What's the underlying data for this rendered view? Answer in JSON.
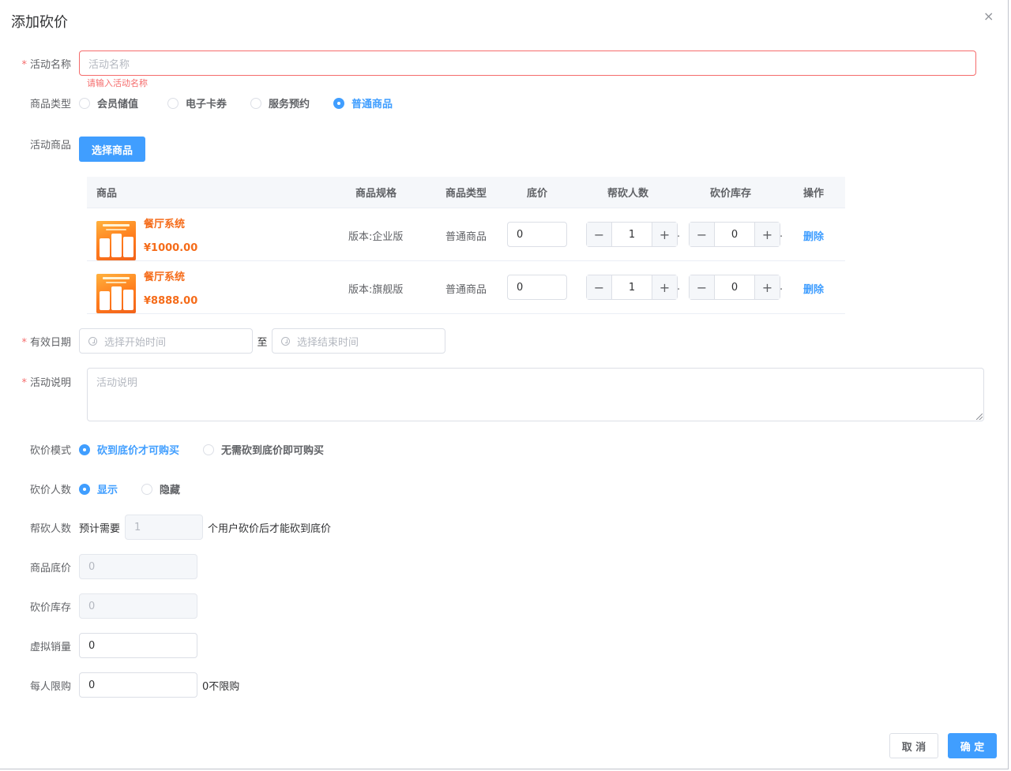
{
  "dialog": {
    "title": "添加砍价",
    "close_glyph": "×"
  },
  "form": {
    "required_mark": "*",
    "activity_name": {
      "label": "活动名称",
      "placeholder": "活动名称",
      "error": "请输入活动名称"
    },
    "product_type": {
      "label": "商品类型",
      "options": [
        "会员储值",
        "电子卡券",
        "服务预约",
        "普通商品"
      ],
      "selected": 3
    },
    "activity_goods": {
      "label": "活动商品",
      "select_button": "选择商品"
    },
    "goods_table": {
      "headers": [
        "商品",
        "商品规格",
        "商品类型",
        "底价",
        "帮砍人数",
        "砍价库存",
        "操作"
      ],
      "rows": [
        {
          "name": "餐厅系统",
          "price": "¥1000.00",
          "spec": "版本:企业版",
          "type": "普通商品",
          "floor_price": "0",
          "helpers": "1",
          "stock": "0",
          "action": "删除"
        },
        {
          "name": "餐厅系统",
          "price": "¥8888.00",
          "spec": "版本:旗舰版",
          "type": "普通商品",
          "floor_price": "0",
          "helpers": "1",
          "stock": "0",
          "action": "删除"
        }
      ],
      "minus": "−",
      "plus": "+",
      "dot": "."
    },
    "valid_date": {
      "label": "有效日期",
      "start_placeholder": "选择开始时间",
      "to": "至",
      "end_placeholder": "选择结束时间"
    },
    "description": {
      "label": "活动说明",
      "placeholder": "活动说明"
    },
    "bargain_mode": {
      "label": "砍价模式",
      "options": [
        "砍到底价才可购买",
        "无需砍到底价即可购买"
      ],
      "selected": 0
    },
    "bargain_count": {
      "label": "砍价人数",
      "options": [
        "显示",
        "隐藏"
      ],
      "selected": 0
    },
    "helper_count": {
      "label": "帮砍人数",
      "prefix": "预计需要",
      "value": "1",
      "suffix": "个用户砍价后才能砍到底价"
    },
    "goods_floor_price": {
      "label": "商品底价",
      "value": "0"
    },
    "bargain_stock": {
      "label": "砍价库存",
      "value": "0"
    },
    "virtual_sales": {
      "label": "虚拟销量",
      "value": "0"
    },
    "purchase_limit": {
      "label": "每人限购",
      "value": "0",
      "hint": "0不限购"
    }
  },
  "footer": {
    "cancel": "取 消",
    "confirm": "确 定"
  },
  "colors": {
    "primary": "#409eff",
    "danger": "#f56c6c",
    "accent": "#f56c1a"
  }
}
